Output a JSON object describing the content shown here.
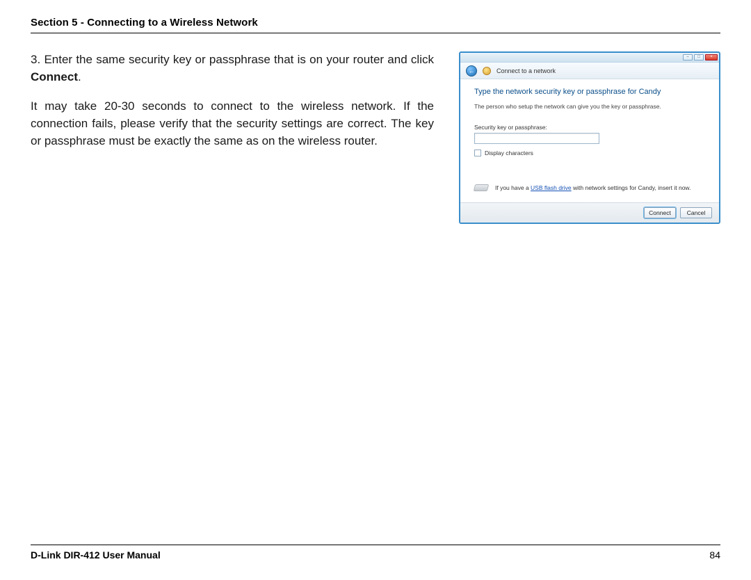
{
  "header": {
    "section_title": "Section 5 - Connecting to a Wireless Network"
  },
  "step": {
    "number": "3.",
    "text_before_bold": "Enter the same security key or passphrase that is on your router and click ",
    "bold_word": "Connect",
    "text_after_bold": "."
  },
  "paragraph2": "It may take 20-30 seconds to connect to the wireless network. If the connection fails, please verify that the security settings are correct. The key or passphrase must be exactly the same as on the wireless router.",
  "dialog": {
    "nav_title": "Connect to a network",
    "heading": "Type the network security key or passphrase for Candy",
    "subtext": "The person who setup the network can give you the key or passphrase.",
    "field_label": "Security key or passphrase:",
    "input_value": "",
    "checkbox_label": "Display characters",
    "usb_text_before": "If you have a ",
    "usb_link": "USB flash drive",
    "usb_text_after": " with network settings for Candy, insert it now.",
    "connect_btn": "Connect",
    "cancel_btn": "Cancel",
    "win_minimize": "–",
    "win_maximize": "□",
    "win_close": "×",
    "back_arrow": "←"
  },
  "footer": {
    "manual_title": "D-Link DIR-412 User Manual",
    "page_number": "84"
  }
}
